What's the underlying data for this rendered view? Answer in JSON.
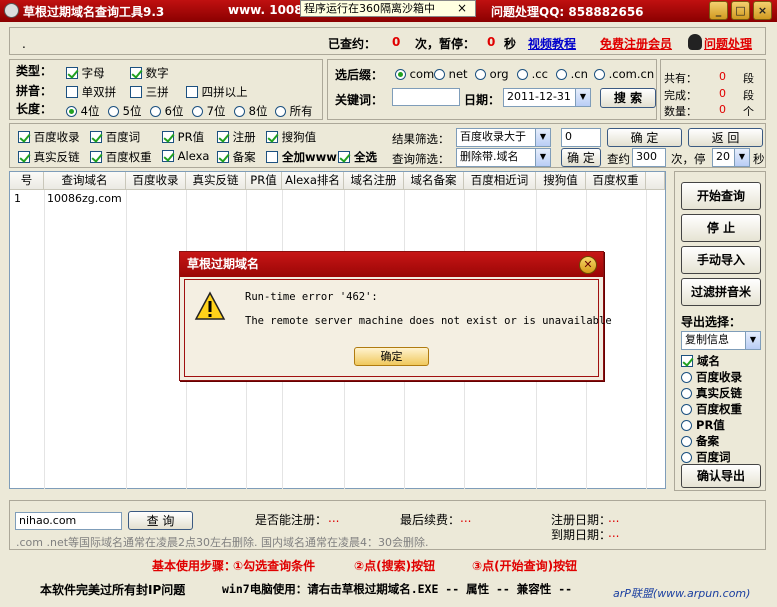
{
  "titlebar": {
    "title": "草根过期域名查询工具9.3",
    "url_fragment": "www. 10086",
    "tooltip": "程序运行在360隔离沙箱中",
    "tooltip_close": "×",
    "help_qq": "问题处理QQ: 858882656",
    "btn_min": "_",
    "btn_max": "□",
    "btn_close": "×"
  },
  "topbar": {
    "checked_label": "已查约：",
    "checked_count": "0",
    "pause_label": "次，暂停：",
    "pause_secs": "0",
    "secs_unit": "秒",
    "video_link": "视频教程",
    "register_link": "免费注册会员",
    "help_link": "问题处理",
    "dot": "."
  },
  "filters": {
    "type_label": "类型：",
    "type_letters": "字母",
    "type_digits": "数字",
    "pinyin_label": "拼音：",
    "pinyin_single_double": "单双拼",
    "pinyin_triple": "三拼",
    "pinyin_four": "四拼以上",
    "length_label": "长度：",
    "lengths": [
      "4位",
      "5位",
      "6位",
      "7位",
      "8位",
      "所有"
    ]
  },
  "suffix": {
    "label": "选后缀：",
    "options": [
      "com",
      "net",
      "org",
      ".cc",
      ".cn",
      ".com.cn"
    ],
    "keyword_label": "关键词：",
    "keyword_value": "",
    "date_label": "日期：",
    "date_value": "2011-12-31",
    "search_btn": "搜 索"
  },
  "stats": {
    "total_label": "共有：",
    "total": "0",
    "total_unit": "段",
    "done_label": "完成：",
    "done": "0",
    "done_unit": "段",
    "count_label": "数量：",
    "count": "0",
    "count_unit": "个"
  },
  "checks": {
    "row1": [
      "百度收录",
      "百度词",
      "PR值",
      "注册",
      "搜狗值"
    ],
    "row2": [
      "真实反链",
      "百度权重",
      "Alexa",
      "备案",
      "全加www",
      "全选"
    ]
  },
  "result_filter": {
    "label": "结果筛选：",
    "select": "百度收录大于",
    "value": "0",
    "confirm_btn": "确 定",
    "back_btn": "返 回",
    "query_label": "查询筛选：",
    "query_select": "删除带.域名",
    "query_confirm": "确 定",
    "check_label": "查约",
    "check_value": "300",
    "times_label": "次，停",
    "stop_value": "20",
    "sec": "秒"
  },
  "grid": {
    "headers": [
      "号",
      "查询域名",
      "百度收录",
      "真实反链",
      "PR值",
      "Alexa排名",
      "域名注册",
      "域名备案",
      "百度相近词",
      "搜狗值",
      "百度权重"
    ],
    "rows": [
      [
        "1",
        "10086zg.com"
      ]
    ]
  },
  "right": {
    "start_btn": "开始查询",
    "stop_btn": "停 止",
    "import_btn": "手动导入",
    "filter_btn": "过滤拼音米",
    "export_label": "导出选择：",
    "export_select": "复制信息",
    "export_domain": "域名",
    "export_opts": [
      "百度收录",
      "真实反链",
      "百度权重",
      "PR值",
      "备案",
      "百度词"
    ],
    "confirm_export": "确认导出"
  },
  "dialog": {
    "title": "草根过期域名",
    "close": "✕",
    "line1": "Run-time error '462':",
    "line2": "The remote server machine does not exist or is unavailable",
    "ok": "确定"
  },
  "bottom": {
    "domain_value": "nihao.com",
    "query_btn": "查 询",
    "can_register_label": "是否能注册：",
    "can_register": "...",
    "last_renew_label": "最后续费：",
    "last_renew": "...",
    "reg_date_label": "注册日期：",
    "reg_date": "...",
    "expire_label": "到期日期：",
    "expire": "...",
    "note": ".com .net等国际域名通常在凌晨2点30左右删除. 国内域名通常在凌晨4：30会删除."
  },
  "steps": {
    "label": "基本使用步骤：",
    "s1": "①勾选查询条件",
    "s2": "②点(搜索)按钮",
    "s3": "③点(开始查询)按钮"
  },
  "footer": {
    "left": "本软件完美过所有封IP问题",
    "middle": "win7电脑使用：请右击草根过期域名.EXE -- 属性 -- 兼容性 --",
    "watermark": "arP联盟(www.arpun.com)"
  },
  "colors": {
    "title_red": "#b00c0c",
    "accent_red": "#e00000",
    "link_blue": "#0000cc"
  }
}
